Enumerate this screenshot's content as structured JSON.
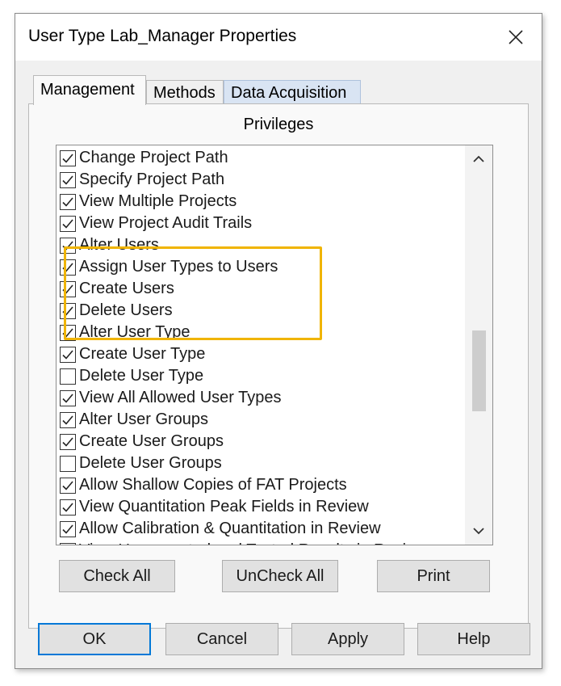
{
  "window": {
    "title": "User Type Lab_Manager Properties",
    "close_icon": "close-icon"
  },
  "tabs": [
    {
      "label": "Management",
      "active": true
    },
    {
      "label": "Methods",
      "active": false
    },
    {
      "label": "Data Acquisition",
      "active": false
    }
  ],
  "privileges": {
    "label": "Privileges",
    "items": [
      {
        "label": "Change Project Path",
        "checked": true
      },
      {
        "label": "Specify Project Path",
        "checked": true
      },
      {
        "label": "View Multiple Projects",
        "checked": true
      },
      {
        "label": "View Project Audit Trails",
        "checked": true
      },
      {
        "label": "Alter Users",
        "checked": true
      },
      {
        "label": "Assign User Types to Users",
        "checked": true
      },
      {
        "label": "Create Users",
        "checked": true
      },
      {
        "label": "Delete Users",
        "checked": true
      },
      {
        "label": "Alter User Type",
        "checked": true
      },
      {
        "label": "Create User Type",
        "checked": true
      },
      {
        "label": "Delete User Type",
        "checked": false
      },
      {
        "label": "View All Allowed User Types",
        "checked": true
      },
      {
        "label": "Alter User Groups",
        "checked": true
      },
      {
        "label": "Create User Groups",
        "checked": true
      },
      {
        "label": "Delete User Groups",
        "checked": false
      },
      {
        "label": "Allow Shallow Copies of FAT Projects",
        "checked": true
      },
      {
        "label": "View Quantitation Peak Fields in Review",
        "checked": true
      },
      {
        "label": "Allow Calibration & Quantitation in Review",
        "checked": true
      },
      {
        "label": "View Unsupported and Tested Results in Review",
        "checked": true
      }
    ]
  },
  "list_buttons": {
    "check_all": "Check All",
    "uncheck_all": "UnCheck All",
    "print": "Print"
  },
  "dialog_buttons": {
    "ok": "OK",
    "cancel": "Cancel",
    "apply": "Apply",
    "help": "Help"
  },
  "colors": {
    "highlight": "#f0b400",
    "default_button_border": "#0078d7",
    "inactive_tab": "#d9e4f3"
  }
}
